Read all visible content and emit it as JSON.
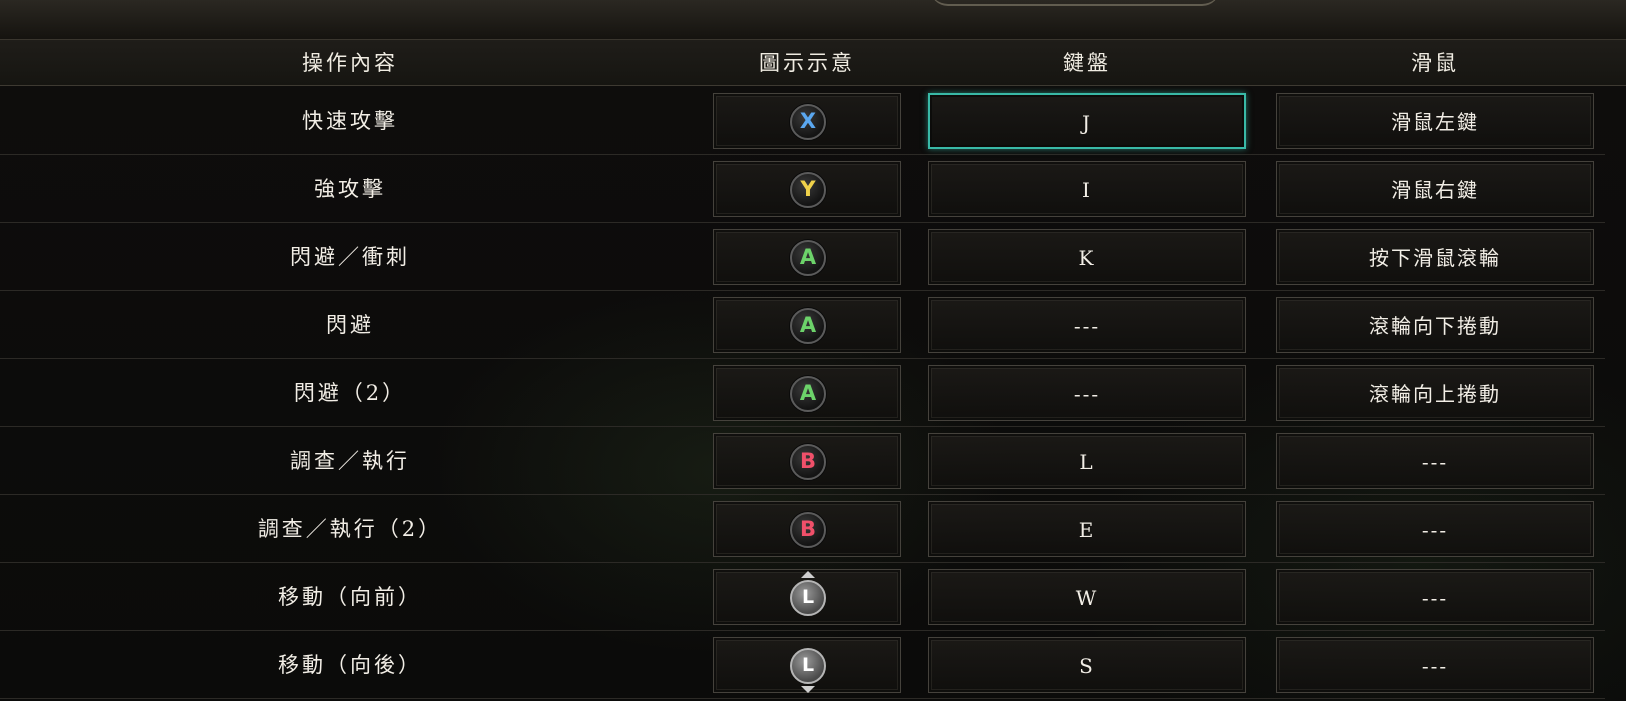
{
  "colors": {
    "x": "#5aa7f0",
    "y": "#f0d24a",
    "a": "#6cd36a",
    "b": "#f0506a",
    "selected": "#39b9a7"
  },
  "header": {
    "operation": "操作內容",
    "icon": "圖示示意",
    "keyboard": "鍵盤",
    "mouse": "滑鼠"
  },
  "rows": [
    {
      "operation": "快速攻擊",
      "button": "X",
      "button_color": "#5aa7f0",
      "icon": "x-button-icon",
      "keyboard": "J",
      "mouse": "滑鼠左鍵"
    },
    {
      "operation": "強攻擊",
      "button": "Y",
      "button_color": "#f0d24a",
      "icon": "y-button-icon",
      "keyboard": "I",
      "mouse": "滑鼠右鍵"
    },
    {
      "operation": "閃避／衝刺",
      "button": "A",
      "button_color": "#6cd36a",
      "icon": "a-button-icon",
      "keyboard": "K",
      "mouse": "按下滑鼠滾輪"
    },
    {
      "operation": "閃避",
      "button": "A",
      "button_color": "#6cd36a",
      "icon": "a-button-icon",
      "keyboard": "---",
      "mouse": "滾輪向下捲動"
    },
    {
      "operation": "閃避（2）",
      "button": "A",
      "button_color": "#6cd36a",
      "icon": "a-button-icon",
      "keyboard": "---",
      "mouse": "滾輪向上捲動"
    },
    {
      "operation": "調查／執行",
      "button": "B",
      "button_color": "#f0506a",
      "icon": "b-button-icon",
      "keyboard": "L",
      "mouse": "---"
    },
    {
      "operation": "調查／執行（2）",
      "button": "B",
      "button_color": "#f0506a",
      "icon": "b-button-icon",
      "keyboard": "E",
      "mouse": "---"
    },
    {
      "operation": "移動（向前）",
      "button": "L",
      "icon": "left-stick-up-icon",
      "keyboard": "W",
      "mouse": "---"
    },
    {
      "operation": "移動（向後）",
      "button": "L",
      "icon": "left-stick-down-icon",
      "keyboard": "S",
      "mouse": "---"
    }
  ]
}
